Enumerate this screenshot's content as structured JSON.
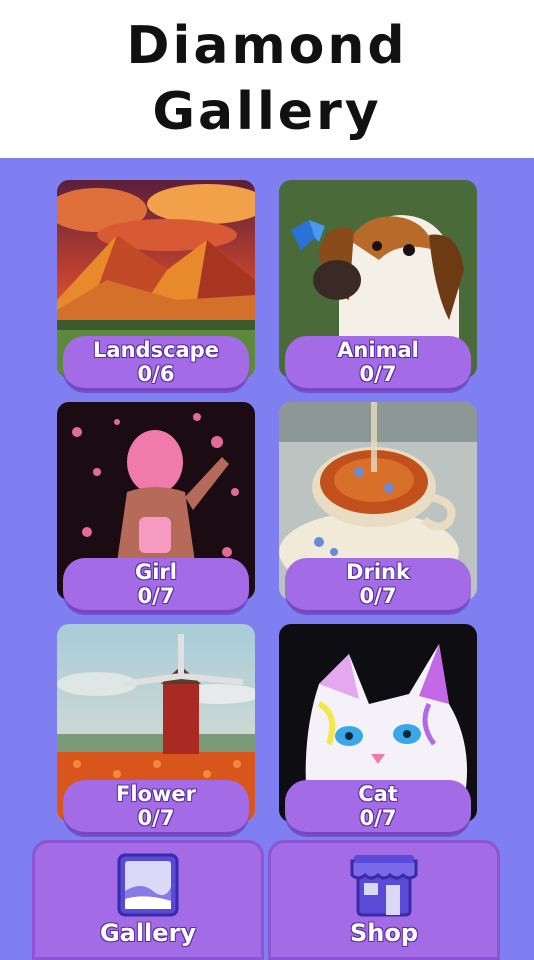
{
  "header": {
    "title_line1": "Diamond",
    "title_line2": "Gallery"
  },
  "categories": [
    {
      "name": "Landscape",
      "progress": "0/6"
    },
    {
      "name": "Animal",
      "progress": "0/7"
    },
    {
      "name": "Girl",
      "progress": "0/7"
    },
    {
      "name": "Drink",
      "progress": "0/7"
    },
    {
      "name": "Flower",
      "progress": "0/7"
    },
    {
      "name": "Cat",
      "progress": "0/7"
    }
  ],
  "tabbar": {
    "gallery_label": "Gallery",
    "shop_label": "Shop"
  },
  "icons": {
    "gallery": "picture-frame-icon",
    "shop": "storefront-icon"
  },
  "colors": {
    "background": "#7f7ff2",
    "pill": "#a36be6",
    "header": "#ffffff"
  }
}
